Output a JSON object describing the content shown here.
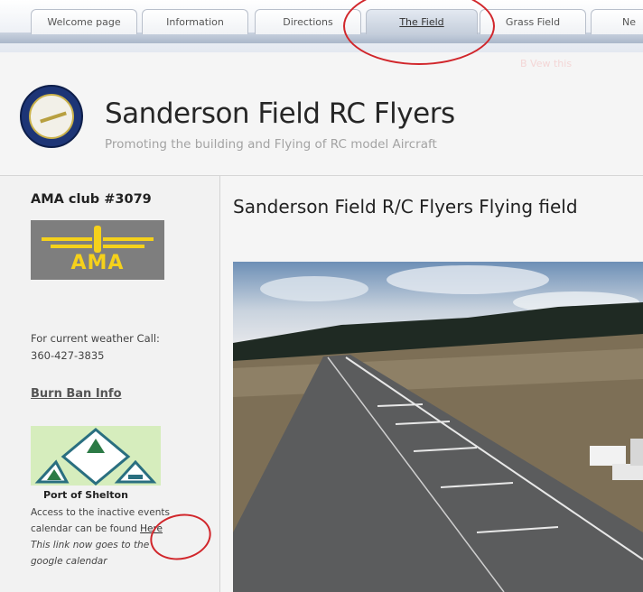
{
  "nav": {
    "tabs": [
      {
        "label": "Welcome page"
      },
      {
        "label": "Information"
      },
      {
        "label": "Directions"
      },
      {
        "label": "The Field",
        "active": true
      },
      {
        "label": "Grass Field"
      },
      {
        "label": "Ne"
      }
    ]
  },
  "header": {
    "title": "Sanderson Field RC Flyers",
    "tagline": "Promoting the building and Flying of RC model Aircraft",
    "faint_overlay_text": "B Vew this"
  },
  "sidebar": {
    "ama_club": "AMA club #3079",
    "ama_logo_text": "AMA",
    "weather_line1": "For current weather Call:",
    "weather_phone": "360-427-3835",
    "burn_ban": "Burn Ban Info",
    "port_title": "Port of Shelton",
    "access_text1": "Access to the inactive events",
    "access_text2": "calendar can be found",
    "access_link": "Here",
    "access_note1": "This link now goes to the",
    "access_note2": "google calendar"
  },
  "main": {
    "title": "Sanderson Field R/C Flyers Flying field"
  },
  "colors": {
    "annotation": "#d1262b",
    "ama_yellow": "#f5d11b",
    "ama_gray": "#7e7e7e"
  }
}
